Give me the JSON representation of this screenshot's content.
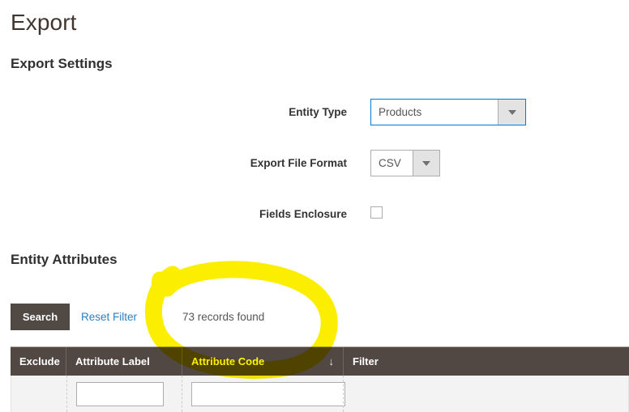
{
  "page": {
    "title": "Export"
  },
  "sections": {
    "export_settings": "Export Settings",
    "entity_attributes": "Entity Attributes"
  },
  "form": {
    "entity_type": {
      "label": "Entity Type",
      "value": "Products",
      "arrow_icon": "chevron-down-icon",
      "focused": true
    },
    "export_file_format": {
      "label": "Export File Format",
      "value": "CSV",
      "arrow_icon": "chevron-down-icon",
      "focused": false
    },
    "fields_enclosure": {
      "label": "Fields Enclosure",
      "checked": false
    }
  },
  "controls": {
    "search_label": "Search",
    "reset_filter_label": "Reset Filter",
    "records_found": "73 records found"
  },
  "grid": {
    "columns": [
      {
        "key": "exclude",
        "label": "Exclude",
        "sorted": false
      },
      {
        "key": "attribute_label",
        "label": "Attribute Label",
        "sorted": false
      },
      {
        "key": "attribute_code",
        "label": "Attribute Code",
        "sorted": true,
        "sort_direction": "↓"
      },
      {
        "key": "filter",
        "label": "Filter",
        "sorted": false
      }
    ],
    "filter_row": {
      "exclude": "",
      "attribute_label": "",
      "attribute_code": "",
      "filter": ""
    },
    "filter_placeholders": {
      "attribute_label": "",
      "attribute_code": ""
    }
  },
  "annotation": {
    "type": "hand-drawn-ellipse-highlight",
    "color": "#ffe800",
    "stroke_width": 21,
    "target": "73 records found"
  },
  "colors": {
    "page_title": "#41362f",
    "heading": "#303030",
    "label": "#333333",
    "link": "#2b7ec0",
    "button_bg": "#514943",
    "grid_header_bg": "#514843",
    "grid_header_text": "#ffffff",
    "grid_sorted_text": "#ffff00",
    "focus_border": "#007bdb",
    "input_border": "#adadad",
    "filter_row_bg": "#f3f3f3",
    "annotation": "#ffe800"
  }
}
